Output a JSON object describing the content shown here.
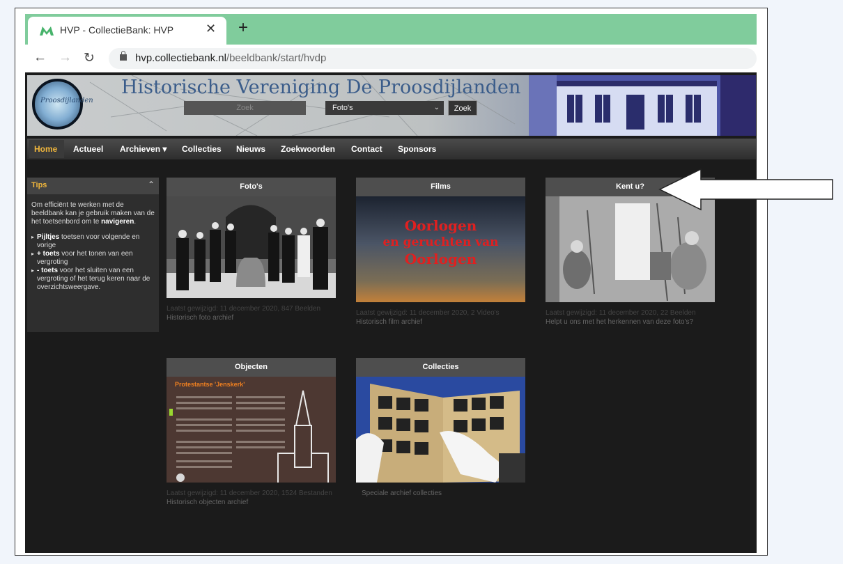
{
  "browser": {
    "tab_title": "HVP - CollectieBank: HVP",
    "url_domain": "hvp.collectiebank.nl",
    "url_path": "/beeldbank/start/hvdp"
  },
  "site": {
    "title": "Historische Vereniging De Proosdijlanden",
    "logo_text": "Proosdijlanden",
    "search_placeholder": "Zoek",
    "select_value": "Foto's",
    "search_button": "Zoek"
  },
  "menu": [
    {
      "label": "Home",
      "active": true
    },
    {
      "label": "Actueel"
    },
    {
      "label": "Archieven ▾"
    },
    {
      "label": "Collecties"
    },
    {
      "label": "Nieuws"
    },
    {
      "label": "Zoekwoorden"
    },
    {
      "label": "Contact"
    },
    {
      "label": "Sponsors"
    }
  ],
  "tips": {
    "title": "Tips",
    "intro_prefix": "Om efficiënt te werken met de beeldbank kan je gebruik maken van de het toetsenbord om te ",
    "intro_bold": "navigeren",
    "intro_suffix": ".",
    "items": [
      {
        "bold": "Pijltjes",
        "text": " toetsen voor volgende en vorige"
      },
      {
        "bold": "+ toets",
        "text": " voor het tonen van een vergroting"
      },
      {
        "bold": "- toets",
        "text": " voor het sluiten van een vergroting of het terug keren naar de overzichtsweergave."
      }
    ]
  },
  "cards": [
    {
      "title": "Foto's",
      "meta": "Laatst gewijzigd: 11 december 2020, 847 Beelden",
      "desc": "Historisch foto archief"
    },
    {
      "title": "Films",
      "meta": "Laatst gewijzigd: 11 december 2020, 2 Video's",
      "desc": "Historisch film archief",
      "img_text_1": "Oorlogen",
      "img_text_2": "en geruchten van",
      "img_text_3": "Oorlogen"
    },
    {
      "title": "Kent u?",
      "meta": "Laatst gewijzigd: 11 december 2020, 22 Beelden",
      "desc": "Helpt u ons met het herkennen van deze foto's?"
    },
    {
      "title": "Objecten",
      "meta": "Laatst gewijzigd: 11 december 2020, 1524 Bestanden",
      "desc": "Historisch objecten archief",
      "img_text_1": "Protestantse 'Jenskerk'"
    },
    {
      "title": "Collecties",
      "meta": "",
      "desc": "Speciale archief collecties"
    }
  ],
  "colors": {
    "tabstrip": "#80cc9c",
    "menu_active": "#f0b63c",
    "site_bg": "#1b1b1b"
  }
}
